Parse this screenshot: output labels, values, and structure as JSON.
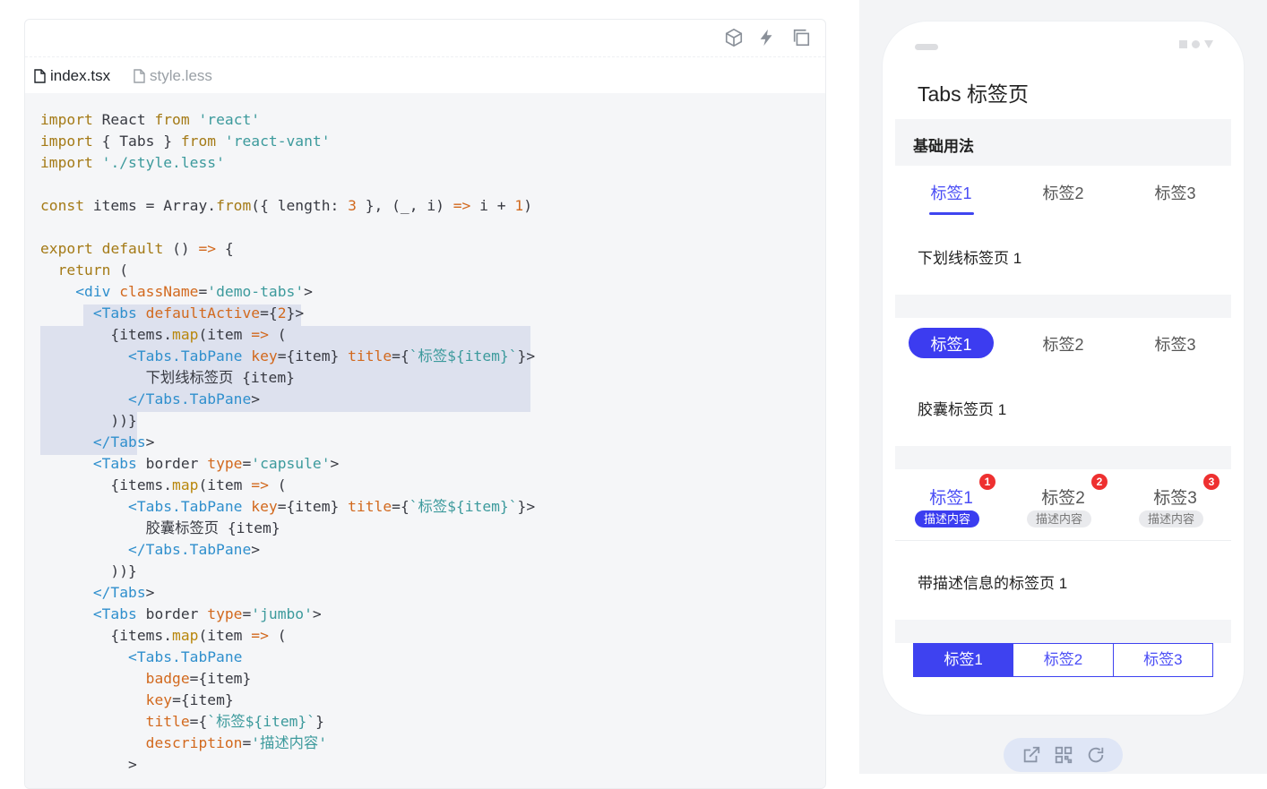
{
  "code_panel": {
    "tools": [
      "codesandbox-icon",
      "lightning-icon",
      "copy-icon"
    ],
    "files": [
      {
        "name": "index.tsx",
        "active": true
      },
      {
        "name": "style.less",
        "active": false
      }
    ],
    "code_lines": [
      "import React from 'react'",
      "import { Tabs } from 'react-vant'",
      "import './style.less'",
      "",
      "const items = Array.from({ length: 3 }, (_, i) => i + 1)",
      "",
      "export default () => {",
      "  return (",
      "    <div className='demo-tabs'>",
      "      <Tabs defaultActive={2}>",
      "        {items.map(item => (",
      "          <Tabs.TabPane key={item} title={`标签${item}`}>",
      "            下划线标签页 {item}",
      "          </Tabs.TabPane>",
      "        ))}",
      "      </Tabs>",
      "      <Tabs border type='capsule'>",
      "        {items.map(item => (",
      "          <Tabs.TabPane key={item} title={`标签${item}`}>",
      "            胶囊标签页 {item}",
      "          </Tabs.TabPane>",
      "        ))}",
      "      </Tabs>",
      "      <Tabs border type='jumbo'>",
      "        {items.map(item => (",
      "          <Tabs.TabPane",
      "            badge={item}",
      "            key={item}",
      "            title={`标签${item}`}",
      "            description='描述内容'",
      "          >"
    ]
  },
  "preview": {
    "page_title": "Tabs 标签页",
    "section_title": "基础用法",
    "underline_tabs": {
      "tabs": [
        "标签1",
        "标签2",
        "标签3"
      ],
      "active": 0,
      "pane": "下划线标签页 1"
    },
    "capsule_tabs": {
      "tabs": [
        "标签1",
        "标签2",
        "标签3"
      ],
      "active": 0,
      "pane": "胶囊标签页 1"
    },
    "jumbo_tabs": {
      "tabs": [
        {
          "title": "标签1",
          "badge": "1",
          "desc": "描述内容"
        },
        {
          "title": "标签2",
          "badge": "2",
          "desc": "描述内容"
        },
        {
          "title": "标签3",
          "badge": "3",
          "desc": "描述内容"
        }
      ],
      "active": 0,
      "pane": "带描述信息的标签页 1"
    },
    "segment_tabs": {
      "tabs": [
        "标签1",
        "标签2",
        "标签3"
      ],
      "active": 0
    }
  },
  "bottom_bar": {
    "icons": [
      "open-external-icon",
      "qrcode-icon",
      "refresh-icon"
    ]
  },
  "colors": {
    "accent": "#3e42f0",
    "badge": "#ee3030",
    "code_bg": "#f5f6f8",
    "highlight": "#dde1ee"
  }
}
